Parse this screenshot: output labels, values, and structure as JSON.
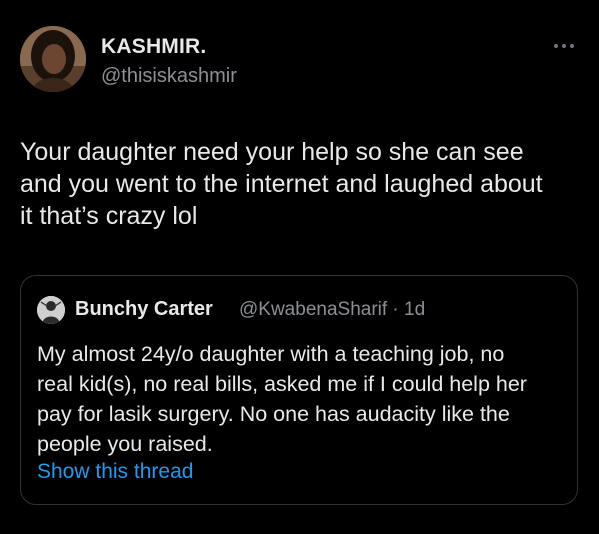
{
  "post": {
    "author_name": "KASHMIR.",
    "author_handle": "@thisiskashmir",
    "text": "Your daughter need your help so she can see\nand you went to the internet and laughed about\nit that’s crazy lol",
    "more_icon": "more-horizontal-icon"
  },
  "quoted_post": {
    "author_name": "Bunchy Carter",
    "meta": "@KwabenaSharif · 1d",
    "text": "My almost 24y/o daughter with a teaching job, no\nreal kid(s), no real bills, asked me if I could help her\npay for lasik surgery. No one has audacity like the\npeople you raised.",
    "show_thread_label": "Show this thread"
  },
  "colors": {
    "background": "#000000",
    "text_primary": "#e7e9ea",
    "text_secondary": "#8b9096",
    "link": "#1d9bf0",
    "border": "#2f3336"
  }
}
